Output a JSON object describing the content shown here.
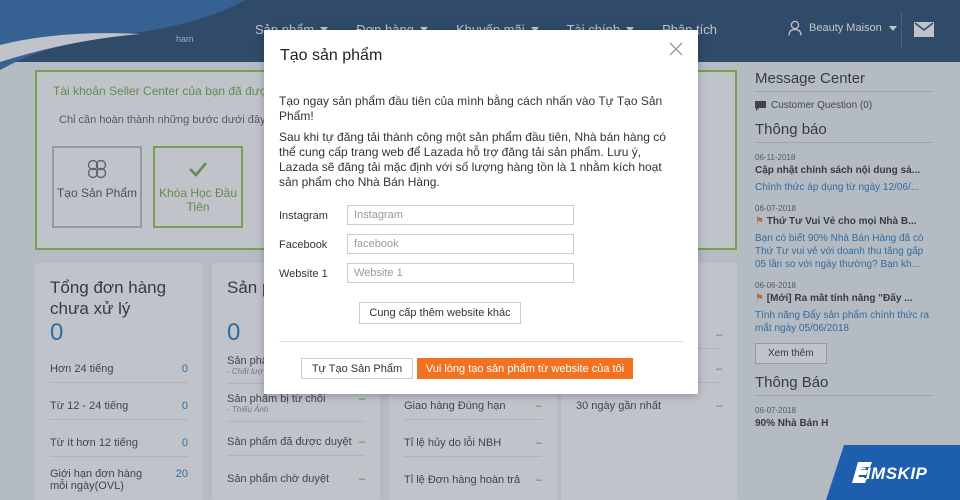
{
  "header": {
    "logo_text": "ham",
    "nav": [
      {
        "label": "Sản phẩm"
      },
      {
        "label": "Đơn hàng"
      },
      {
        "label": "Khuyến mãi"
      },
      {
        "label": "Tài chính"
      },
      {
        "label": "Phân tích"
      }
    ],
    "user_name": "Beauty Maison"
  },
  "dashboard": {
    "alert_title": "Tài khoản Seller Center của bạn đã được",
    "alert_subtitle": "Chỉ cần hoàn thành những bước dưới đây l",
    "steps": [
      {
        "label": "Tạo Sản Phẩm"
      },
      {
        "label": "Khóa Học Đầu Tiên"
      }
    ],
    "orders_card": {
      "title": "Tổng đơn hàng chưa xử lý",
      "count": "0",
      "rows": [
        {
          "label": "Hơn 24 tiếng",
          "value": "0"
        },
        {
          "label": "Từ 12 - 24 tiếng",
          "value": "0"
        },
        {
          "label": "Từ ít hơn 12 tiếng",
          "value": "0"
        },
        {
          "label": "Giới hạn đơn hàng mỗi ngày(OVL)",
          "value": "20"
        }
      ]
    },
    "products_card": {
      "title": "Sản p",
      "count": "0",
      "rows": [
        {
          "label": "Sản phẩ",
          "sub": "- Chất lượ",
          "value": ""
        },
        {
          "label": "Sản phẩm bị từ chối",
          "sub": "- Thiếu Ảnh",
          "value": "–"
        },
        {
          "label": "Sản phẩm đã được duyệt",
          "value": "–"
        },
        {
          "label": "Sản phẩm chờ duyệt",
          "value": "–"
        }
      ]
    },
    "metrics_card": {
      "rows": [
        {
          "label": "Giao hàng Đúng hạn",
          "value": "–"
        },
        {
          "label": "Tỉ lệ hủy do lỗi NBH",
          "value": "–"
        },
        {
          "label": "Tỉ lệ Đơn hàng hoàn trả",
          "value": "–"
        }
      ]
    },
    "fourth_card": {
      "rows": [
        {
          "label": "",
          "value": "–"
        },
        {
          "label": "",
          "value": "–"
        },
        {
          "label": "30 ngày gần nhất",
          "value": "–"
        }
      ]
    }
  },
  "right": {
    "message_center_title": "Message Center",
    "customer_question": "Customer Question (0)",
    "notices_title": "Thông báo",
    "news": [
      {
        "date": "06-11-2018",
        "title": "Cập nhật chính sách nội dung sả...",
        "body": "Chính thức áp dụng từ ngày 12/06/..."
      },
      {
        "date": "06-07-2018",
        "title": "Thứ Tư Vui Vẻ cho mọi Nhà B...",
        "body": "Bạn có biết 90% Nhà Bán Hàng đã có Thứ Tư vui vẻ với doanh thu tăng gấp 05 lần so với ngày thường? Bạn kh..."
      },
      {
        "date": "06-06-2018",
        "title": "[Mới] Ra mắt tính năng \"Đẩy ...",
        "body": "Tính năng Đẩy sản phẩm chính thức ra mắt ngày 05/06/2018"
      }
    ],
    "more_label": "Xem thêm",
    "announce_title": "Thông Báo",
    "announce": [
      {
        "date": "06-07-2018",
        "title": "90% Nhà Bán H"
      }
    ]
  },
  "modal": {
    "title": "Tạo sản phẩm",
    "paragraph1": "Tạo ngay sản phẩm đầu tiên của mình bằng cách nhấn vào Tự Tạo Sản Phẩm!",
    "paragraph2": "Sau khi tự đăng tải thành công một sản phẩm đầu tiên, Nhà bán hàng có thể cung cấp trang web để Lazada hỗ trợ đăng tải sản phẩm. Lưu ý, Lazada sẽ đăng tải mặc định với số lượng hàng tồn là 1 nhằm kích hoạt sản phẩm cho Nhà Bán Hàng.",
    "fields": {
      "instagram": {
        "label": "Instagram",
        "placeholder": "Instagram",
        "value": ""
      },
      "facebook": {
        "label": "Facebook",
        "placeholder": "facebook",
        "value": ""
      },
      "website": {
        "label": "Website 1",
        "placeholder": "Website 1",
        "value": ""
      }
    },
    "add_website_label": "Cung cấp thêm website khác",
    "self_create_label": "Tự Tạo Sản Phẩm",
    "web_create_label": "Vui lòng tạo sản phẩm từ website của tôi"
  },
  "watermark": {
    "text": "EIMSKIP"
  },
  "colors": {
    "header_bg": "#183d63",
    "accent_orange": "#f27221",
    "accent_green": "#8cc63f",
    "link_blue": "#1a71b8"
  }
}
